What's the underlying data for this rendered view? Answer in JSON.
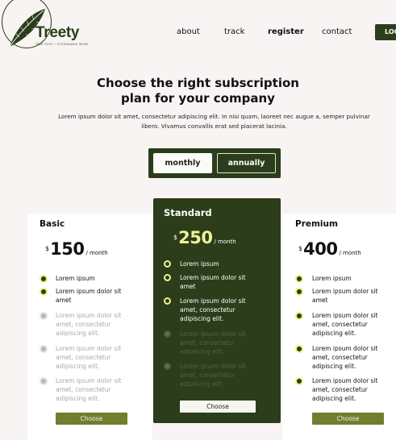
{
  "brand": {
    "name": "Treety",
    "tagline": "TREE SHOP • SUSTAINABLE WORK"
  },
  "nav": {
    "items": [
      "about",
      "track",
      "register",
      "contact"
    ],
    "login": "LOG"
  },
  "hero": {
    "title_line1": "Choose the right subscription",
    "title_line2": "plan for your company",
    "description": "Lorem ipsum dolor sit amet, consectetur adipiscing elit. In nisi quam, laoreet nec augue a, semper pulvinar libero. Vivamus convallis erat sed placerat lacinia."
  },
  "billing": {
    "monthly": "monthly",
    "annually": "annually",
    "selected": "monthly"
  },
  "plans": [
    {
      "name": "Basic",
      "currency": "$",
      "price": "150",
      "period": "/ month",
      "features": [
        {
          "text": "Lorem ipsum",
          "enabled": true
        },
        {
          "text": "Lorem ipsum dolor sit amet",
          "enabled": true
        },
        {
          "text": "Lorem ipsum dolor sit amet, consectetur adipiscing elit.",
          "enabled": false
        },
        {
          "text": "Lorem ipsum dolor sit amet, consectetur adipiscing elit.",
          "enabled": false
        },
        {
          "text": "Lorem ipsum dolor sit amet, consectetur adipiscing elit.",
          "enabled": false
        }
      ],
      "button": "Choose"
    },
    {
      "name": "Standard",
      "currency": "$",
      "price": "250",
      "period": "/ month",
      "features": [
        {
          "text": "Lorem ipsum",
          "enabled": true
        },
        {
          "text": "Lorem ipsum dolor sit amet",
          "enabled": true
        },
        {
          "text": "Lorem ipsum dolor sit amet, consectetur adipiscing elit.",
          "enabled": true
        },
        {
          "text": "Lorem ipsum dolor sit amet, consectetur adipiscing elit.",
          "enabled": false
        },
        {
          "text": "Lorem ipsum dolor sit amet, consectetur adipiscing elit.",
          "enabled": false
        }
      ],
      "button": "Choose"
    },
    {
      "name": "Premium",
      "currency": "$",
      "price": "400",
      "period": "/ month",
      "features": [
        {
          "text": "Lorem ipsum",
          "enabled": true
        },
        {
          "text": "Lorem ipsum dolor sit amet",
          "enabled": true
        },
        {
          "text": "Lorem ipsum dolor sit amet, consectetur adipiscing elit.",
          "enabled": true
        },
        {
          "text": "Lorem ipsum dolor sit amet, consectetur adipiscing elit.",
          "enabled": true
        },
        {
          "text": "Lorem ipsum dolor sit amet, consectetur adipiscing elit.",
          "enabled": true
        }
      ],
      "button": "Choose"
    }
  ],
  "colors": {
    "brand_green": "#2b3d1a",
    "accent_lime": "#eef29a",
    "button_olive": "#6f7f2d",
    "background": "#f8f4f3"
  }
}
